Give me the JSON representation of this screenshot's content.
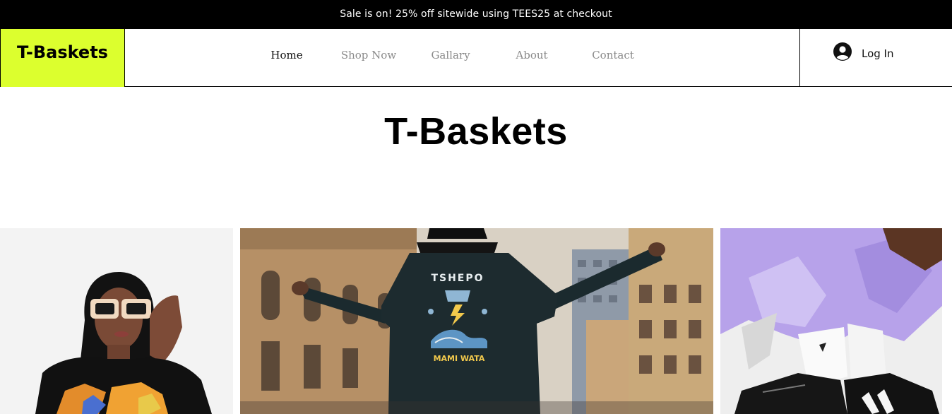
{
  "announcement": "Sale is on! 25% off sitewide using TEES25 at checkout",
  "header": {
    "logo": "T-Baskets",
    "nav": [
      {
        "label": "Home",
        "active": true
      },
      {
        "label": "Shop Now",
        "active": false
      },
      {
        "label": "Gallary",
        "active": false
      },
      {
        "label": "About",
        "active": false
      },
      {
        "label": "Contact",
        "active": false
      }
    ],
    "login_label": "Log In"
  },
  "hero": {
    "title": "T-Baskets"
  },
  "gallery": {
    "images": [
      {
        "icon": "woman-sunglasses-photo"
      },
      {
        "icon": "man-jacket-city-photo",
        "jacket_text_top": "TSHEPO",
        "jacket_text_bottom": "MAMI WATA"
      },
      {
        "icon": "sneakers-socks-photo"
      }
    ]
  },
  "colors": {
    "logo_bg": "#dcff2e",
    "announce_bg": "#000000",
    "nav_active": "#111111",
    "nav_inactive": "#8a8a8a"
  }
}
